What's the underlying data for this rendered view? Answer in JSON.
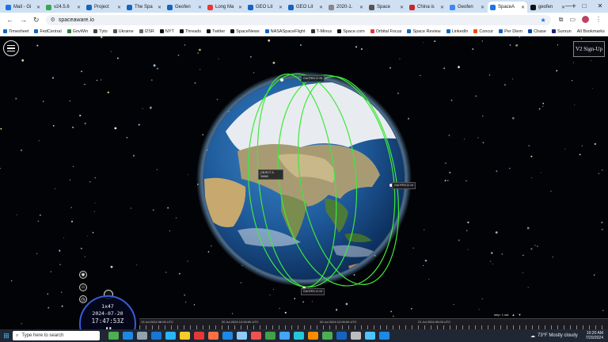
{
  "browser": {
    "tabs": [
      {
        "label": "Mail - Gi",
        "color": "#1a73e8"
      },
      {
        "label": "v24.5.6",
        "color": "#34a853"
      },
      {
        "label": "Project",
        "color": "#1565c0"
      },
      {
        "label": "The Spa",
        "color": "#1565c0"
      },
      {
        "label": "Geofen",
        "color": "#1565c0"
      },
      {
        "label": "Long Ma",
        "color": "#e53935"
      },
      {
        "label": "GEO Lit",
        "color": "#1565c0"
      },
      {
        "label": "GEO Lit",
        "color": "#1565c0"
      },
      {
        "label": "2020-1.",
        "color": "#888888"
      },
      {
        "label": "Space",
        "color": "#555555"
      },
      {
        "label": "China is",
        "color": "#c62828"
      },
      {
        "label": "Geofen",
        "color": "#4285f4"
      },
      {
        "label": "SpaceA",
        "color": "#1a73e8",
        "active": true
      },
      {
        "label": "geofen",
        "color": "#111111"
      }
    ],
    "url": "spaceaware.io",
    "bookmarks": [
      {
        "label": "Timesheet",
        "color": "#1565c0"
      },
      {
        "label": "FedCentral",
        "color": "#1565c0"
      },
      {
        "label": "GovWin",
        "color": "#2e7d32"
      },
      {
        "label": "Tyto",
        "color": "#444444"
      },
      {
        "label": "Ukraine",
        "color": "#555555"
      },
      {
        "label": "I2SR",
        "color": "#666666"
      },
      {
        "label": "NYT",
        "color": "#111111"
      },
      {
        "label": "Threads",
        "color": "#111111"
      },
      {
        "label": "Twitter",
        "color": "#111111"
      },
      {
        "label": "SpaceNews",
        "color": "#111111"
      },
      {
        "label": "NASASpaceFlight",
        "color": "#1565c0"
      },
      {
        "label": "T-Minus",
        "color": "#333333"
      },
      {
        "label": "Space.com",
        "color": "#111111"
      },
      {
        "label": "Orbital Focus",
        "color": "#e53935"
      },
      {
        "label": "Space Review",
        "color": "#1565c0"
      },
      {
        "label": "LinkedIn",
        "color": "#0a66c2"
      },
      {
        "label": "Concur",
        "color": "#e65100"
      },
      {
        "label": "Per Diem",
        "color": "#1565c0"
      },
      {
        "label": "Chase",
        "color": "#0d47a1"
      },
      {
        "label": "Sunrun",
        "color": "#1a237e"
      }
    ],
    "all_bookmarks": "All Bookmarks"
  },
  "app": {
    "signup": "V2 Sign-Up",
    "object_labels": [
      "GAOFEN 11 05",
      "OBJECT A",
      "GAOFEN 11 04",
      "GAOFEN 11 02"
    ],
    "object_sublabels": [
      "",
      "46868",
      "",
      ""
    ],
    "clock": {
      "speed": "1x47",
      "date": "2024-07-20",
      "time": "17:47:53Z",
      "pause": "❚❚"
    },
    "timeline_dates": [
      "13 Jul 2024 06:00 UTC",
      "20 Jul 2024 12:00:00 UTC",
      "20 Jul 2024 12:00:00 UTC",
      "21 Jul 2024 00:00 UTC"
    ],
    "timeline_control": "step: 1 sat"
  },
  "taskbar": {
    "search_placeholder": "Type here to search",
    "apps": [
      "#4caf50",
      "#1e88e5",
      "#90a4ae",
      "#1976d2",
      "#29b6f6",
      "#ffca28",
      "#e53935",
      "#ff7043",
      "#1e88e5",
      "#90caf9",
      "#ef5350",
      "#43a047",
      "#42a5f5",
      "#26c6da",
      "#fb8c00",
      "#4caf50",
      "#1565c0",
      "#bdbdbd",
      "#4fc3f7",
      "#1e88e5"
    ],
    "weather": "73°F  Mostly cloudy",
    "time": "10:20 AM",
    "date": "7/20/2024"
  }
}
